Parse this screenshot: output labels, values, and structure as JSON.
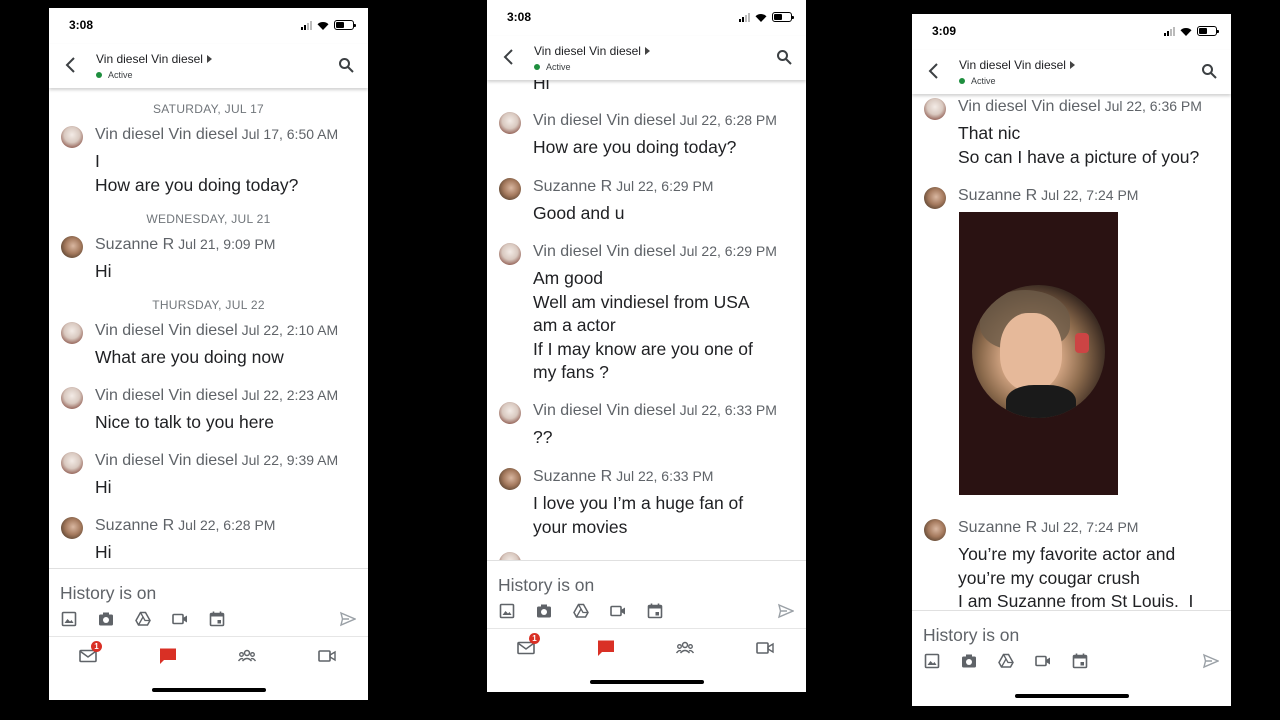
{
  "phones": [
    {
      "status": {
        "time": "3:08"
      },
      "header": {
        "contact_name": "Vin diesel Vin diesel",
        "presence": "Active"
      },
      "days": [
        "SATURDAY, JUL 17",
        "WEDNESDAY, JUL 21",
        "THURSDAY, JUL 22"
      ],
      "messages": [
        {
          "sender": "Vin diesel Vin diesel",
          "time": "Jul 17, 6:50 AM",
          "text": "I\nHow are you doing today?"
        },
        {
          "sender": "Suzanne R",
          "time": "Jul 21, 9:09 PM",
          "text": "Hi"
        },
        {
          "sender": "Vin diesel Vin diesel",
          "time": "Jul 22, 2:10 AM",
          "text": "What are you doing now"
        },
        {
          "sender": "Vin diesel Vin diesel",
          "time": "Jul 22, 2:23 AM",
          "text": "Nice to talk to you here"
        },
        {
          "sender": "Vin diesel Vin diesel",
          "time": "Jul 22, 9:39 AM",
          "text": "Hi"
        },
        {
          "sender": "Suzanne R",
          "time": "Jul 22, 6:28 PM",
          "text": "Hi"
        }
      ],
      "composer": {
        "history": "History is on"
      },
      "nav": {
        "mail_badge": "1"
      }
    },
    {
      "status": {
        "time": "3:08"
      },
      "header": {
        "contact_name": "Vin diesel Vin diesel",
        "presence": "Active"
      },
      "partial_top": "Hi",
      "messages": [
        {
          "sender": "Vin diesel Vin diesel",
          "time": "Jul 22, 6:28 PM",
          "text": "How are you doing today?"
        },
        {
          "sender": "Suzanne R",
          "time": "Jul 22, 6:29 PM",
          "text": "Good and u"
        },
        {
          "sender": "Vin diesel Vin diesel",
          "time": "Jul 22, 6:29 PM",
          "text": "Am good\nWell am vindiesel from USA\nam a actor\nIf I may know are you one of\nmy fans ?"
        },
        {
          "sender": "Vin diesel Vin diesel",
          "time": "Jul 22, 6:33 PM",
          "text": "??"
        },
        {
          "sender": "Suzanne R",
          "time": "Jul 22, 6:33 PM",
          "text": "I love you I’m a huge fan of\nyour movies"
        }
      ],
      "composer": {
        "history": "History is on"
      },
      "nav": {
        "mail_badge": "1"
      }
    },
    {
      "status": {
        "time": "3:09"
      },
      "header": {
        "contact_name": "Vin diesel Vin diesel",
        "presence": "Active"
      },
      "messages": [
        {
          "sender": "Vin diesel Vin diesel",
          "time": "Jul 22, 6:36 PM",
          "text": "That nic\nSo can I have a picture of you?"
        },
        {
          "sender": "Suzanne R",
          "time": "Jul 22, 7:24 PM",
          "text": ""
        },
        {
          "sender": "Suzanne R",
          "time": "Jul 22, 7:24 PM",
          "text": "You’re my favorite actor and\nyou’re my cougar crush\nI am Suzanne from St Louis.  I"
        }
      ],
      "composer": {
        "history": "History is on"
      }
    }
  ],
  "colors": {
    "accent_red": "#d93025",
    "active_green": "#1e8e3e",
    "text_primary": "#202124",
    "text_secondary": "#5f6368"
  },
  "icons": [
    "back-arrow-icon",
    "search-icon",
    "image-icon",
    "camera-icon",
    "drive-icon",
    "video-icon",
    "calendar-icon",
    "send-icon",
    "mail-icon",
    "chat-icon",
    "rooms-icon",
    "meet-icon"
  ]
}
